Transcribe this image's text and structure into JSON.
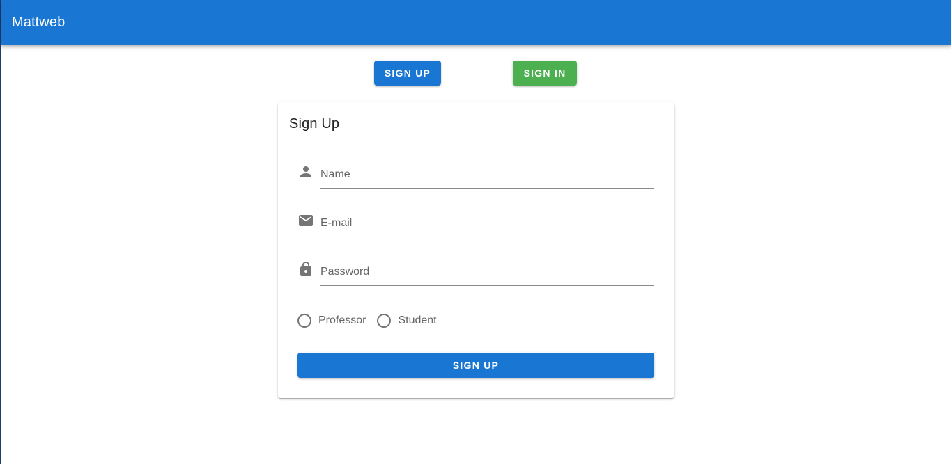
{
  "app_bar": {
    "title": "Mattweb",
    "color": "#1976d2"
  },
  "top_actions": {
    "sign_up_label": "SIGN UP",
    "sign_in_label": "SIGN IN",
    "sign_up_color": "#1976d2",
    "sign_in_color": "#4caf50"
  },
  "form": {
    "title": "Sign Up",
    "fields": [
      {
        "icon": "person-icon",
        "placeholder": "Name",
        "value": ""
      },
      {
        "icon": "email-icon",
        "placeholder": "E-mail",
        "value": ""
      },
      {
        "icon": "lock-icon",
        "placeholder": "Password",
        "value": ""
      }
    ],
    "role_options": [
      {
        "label": "Professor",
        "selected": false
      },
      {
        "label": "Student",
        "selected": false
      }
    ],
    "submit_label": "SIGN UP"
  }
}
